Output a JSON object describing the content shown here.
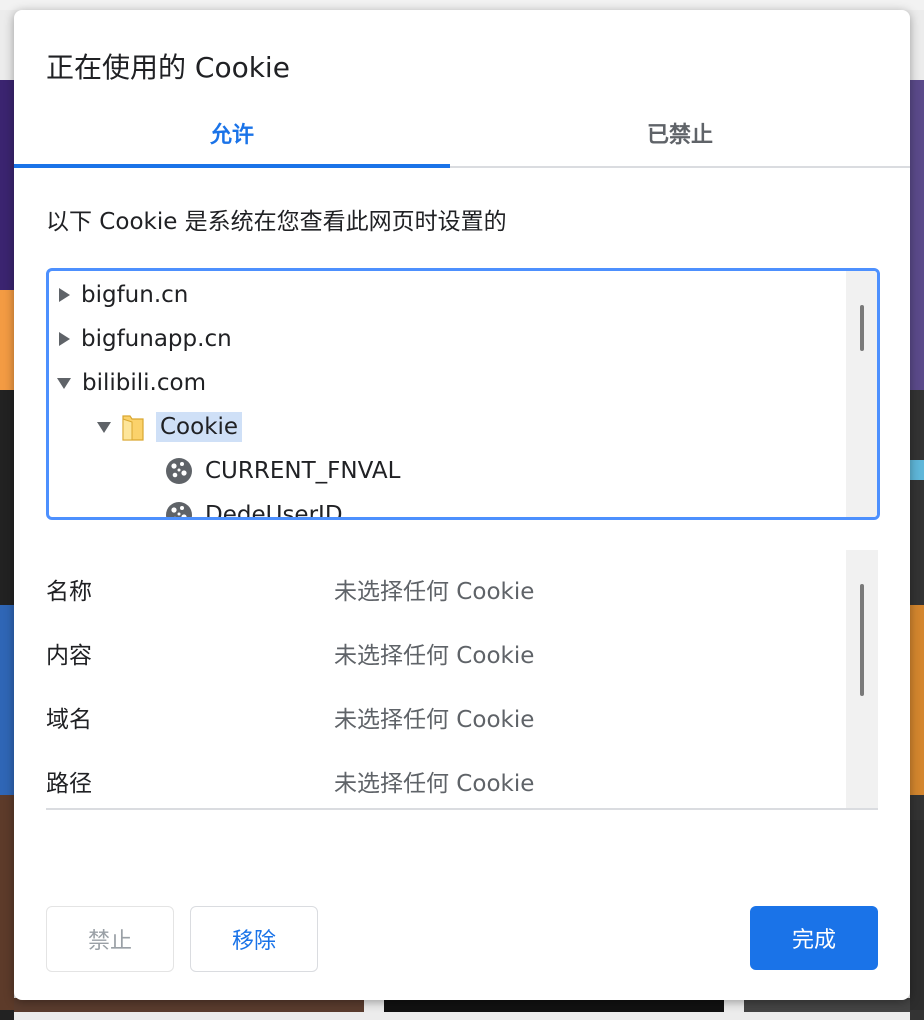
{
  "dialog": {
    "title": "正在使用的 Cookie",
    "tabs": [
      {
        "label": "允许",
        "active": true
      },
      {
        "label": "已禁止",
        "active": false
      }
    ],
    "description": "以下 Cookie 是系统在您查看此网页时设置的"
  },
  "tree": {
    "items": [
      {
        "label": "bigfun.cn",
        "expanded": false
      },
      {
        "label": "bigfunapp.cn",
        "expanded": false
      },
      {
        "label": "bilibili.com",
        "expanded": true
      },
      {
        "label": "Cookie",
        "expanded": true,
        "selected": true
      },
      {
        "label": "CURRENT_FNVAL"
      },
      {
        "label": "DedeUserID"
      }
    ]
  },
  "details": {
    "rows": [
      {
        "label": "名称",
        "value": "未选择任何 Cookie"
      },
      {
        "label": "内容",
        "value": "未选择任何 Cookie"
      },
      {
        "label": "域名",
        "value": "未选择任何 Cookie"
      },
      {
        "label": "路径",
        "value": "未选择任何 Cookie"
      }
    ]
  },
  "buttons": {
    "block": "禁止",
    "remove": "移除",
    "done": "完成"
  },
  "colors": {
    "accent": "#1a73e8",
    "selection": "#cfe0f7",
    "tree_border": "#4d90fe",
    "folder": "#fbd26b"
  }
}
